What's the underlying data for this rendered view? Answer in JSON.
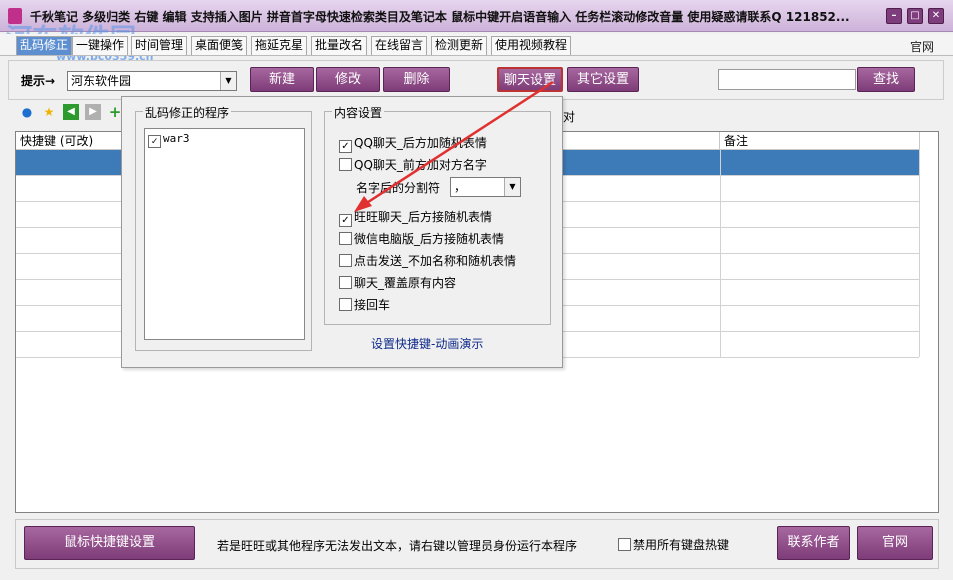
{
  "window": {
    "title": "千秋笔记   多级归类   右键 编辑 支持插入图片   拼音首字母快速检索类目及笔记本   鼠标中键开启语音输入   任务栏滚动修改音量   使用疑惑请联系Q 121852...",
    "min_icon": "minimize-icon",
    "max_icon": "maximize-icon",
    "close_icon": "close-icon"
  },
  "tabs": [
    "乱码修正",
    "一键操作",
    "时间管理",
    "桌面便笺",
    "拖延克星",
    "批量改名",
    "在线留言",
    "检测更新",
    "使用视频教程"
  ],
  "tab_link": "官网",
  "toolbar": {
    "hint_label": "提示→",
    "combo_value": "河东软件园",
    "new_label": "新建",
    "edit_label": "修改",
    "delete_label": "删除",
    "chat_settings_label": "聊天设置",
    "other_settings_label": "其它设置",
    "search_label": "查找"
  },
  "list": {
    "col_shortcut": "快捷键 (可改)",
    "col_note": "备注",
    "partial_hidden_text": "对"
  },
  "popup": {
    "group_programs": "乱码修正的程序",
    "program_item": "war3",
    "group_content": "内容设置",
    "opt_qq_random": "QQ聊天_后方加随机表情",
    "opt_qq_name": "QQ聊天_前方加对方名字",
    "separator_label": "名字后的分割符",
    "separator_value": "，",
    "opt_wangwang": "旺旺聊天_后方接随机表情",
    "opt_wechat": "微信电脑版_后方接随机表情",
    "opt_click_send": "点击发送_不加名称和随机表情",
    "opt_overwrite": "聊天_覆盖原有内容",
    "opt_enter": "接回车",
    "demo_link": "设置快捷键-动画演示"
  },
  "bottom": {
    "mouse_shortcut_label": "鼠标快捷键设置",
    "hint_text": "若是旺旺或其他程序无法发出文本，请右键以管理员身份运行本程序",
    "disable_hotkeys_label": "禁用所有键盘热键",
    "contact_label": "联系作者",
    "website_label": "官网"
  },
  "watermark": {
    "brand": "河东软件园",
    "url": "www.pc0359.cn"
  },
  "colors": {
    "button_purple": "#8e4a88",
    "selected_row": "#3c7bb8",
    "arrow_red": "#e03030"
  }
}
